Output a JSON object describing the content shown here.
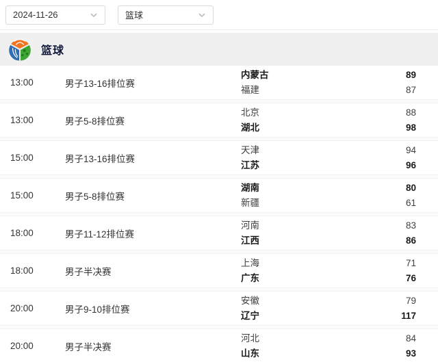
{
  "filters": {
    "date": {
      "value": "2024-11-26"
    },
    "sport": {
      "value": "篮球"
    }
  },
  "section": {
    "title": "篮球",
    "icon": "multi-sport-ball-logo"
  },
  "matches": [
    {
      "time": "13:00",
      "event": "男子13-16排位赛",
      "teams": [
        {
          "name": "内蒙古",
          "score": "89",
          "winner": true
        },
        {
          "name": "福建",
          "score": "87",
          "winner": false
        }
      ]
    },
    {
      "time": "13:00",
      "event": "男子5-8排位赛",
      "teams": [
        {
          "name": "北京",
          "score": "88",
          "winner": false
        },
        {
          "name": "湖北",
          "score": "98",
          "winner": true
        }
      ]
    },
    {
      "time": "15:00",
      "event": "男子13-16排位赛",
      "teams": [
        {
          "name": "天津",
          "score": "94",
          "winner": false
        },
        {
          "name": "江苏",
          "score": "96",
          "winner": true
        }
      ]
    },
    {
      "time": "15:00",
      "event": "男子5-8排位赛",
      "teams": [
        {
          "name": "湖南",
          "score": "80",
          "winner": true
        },
        {
          "name": "新疆",
          "score": "61",
          "winner": false
        }
      ]
    },
    {
      "time": "18:00",
      "event": "男子11-12排位赛",
      "teams": [
        {
          "name": "河南",
          "score": "83",
          "winner": false
        },
        {
          "name": "江西",
          "score": "86",
          "winner": true
        }
      ]
    },
    {
      "time": "18:00",
      "event": "男子半决赛",
      "teams": [
        {
          "name": "上海",
          "score": "71",
          "winner": false
        },
        {
          "name": "广东",
          "score": "76",
          "winner": true
        }
      ]
    },
    {
      "time": "20:00",
      "event": "男子9-10排位赛",
      "teams": [
        {
          "name": "安徽",
          "score": "79",
          "winner": false
        },
        {
          "name": "辽宁",
          "score": "117",
          "winner": true
        }
      ]
    },
    {
      "time": "20:00",
      "event": "男子半决赛",
      "teams": [
        {
          "name": "河北",
          "score": "84",
          "winner": false
        },
        {
          "name": "山东",
          "score": "93",
          "winner": true
        }
      ]
    }
  ],
  "colors": {
    "section_band": "#f0f0f0",
    "title_text": "#10183a",
    "logo_orange": "#f07522",
    "logo_blue": "#2f6db4",
    "logo_green": "#3fa535"
  }
}
